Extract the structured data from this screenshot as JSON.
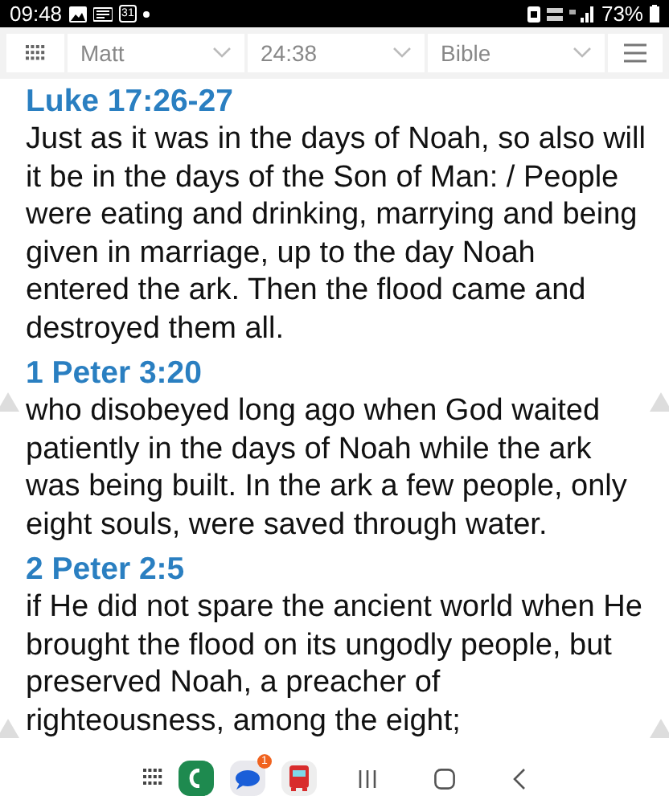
{
  "status_bar": {
    "time": "09:48",
    "calendar_day": "31",
    "battery": "73%"
  },
  "toolbar": {
    "dropdowns": [
      {
        "value": "Matt"
      },
      {
        "value": "24:38"
      },
      {
        "value": "Bible"
      }
    ]
  },
  "passages": [
    {
      "reference": "Luke 17:26-27",
      "text": "Just as it was in the days of Noah, so also will it be in the days of the Son of Man: / People were eating and drinking, marrying and being given in marriage, up to the day Noah entered the ark. Then the flood came and destroyed them all."
    },
    {
      "reference": "1 Peter 3:20",
      "text": "who disobeyed long ago when God waited patiently in the days of Noah while the ark was being built. In the ark a few people, only eight souls, were saved through water."
    },
    {
      "reference": "2 Peter 2:5",
      "text": "if He did not spare the ancient world when He brought the flood on its ungodly people, but preserved Noah, a preacher of righteousness, among the eight;"
    }
  ],
  "dock": {
    "messages_badge": "1"
  }
}
